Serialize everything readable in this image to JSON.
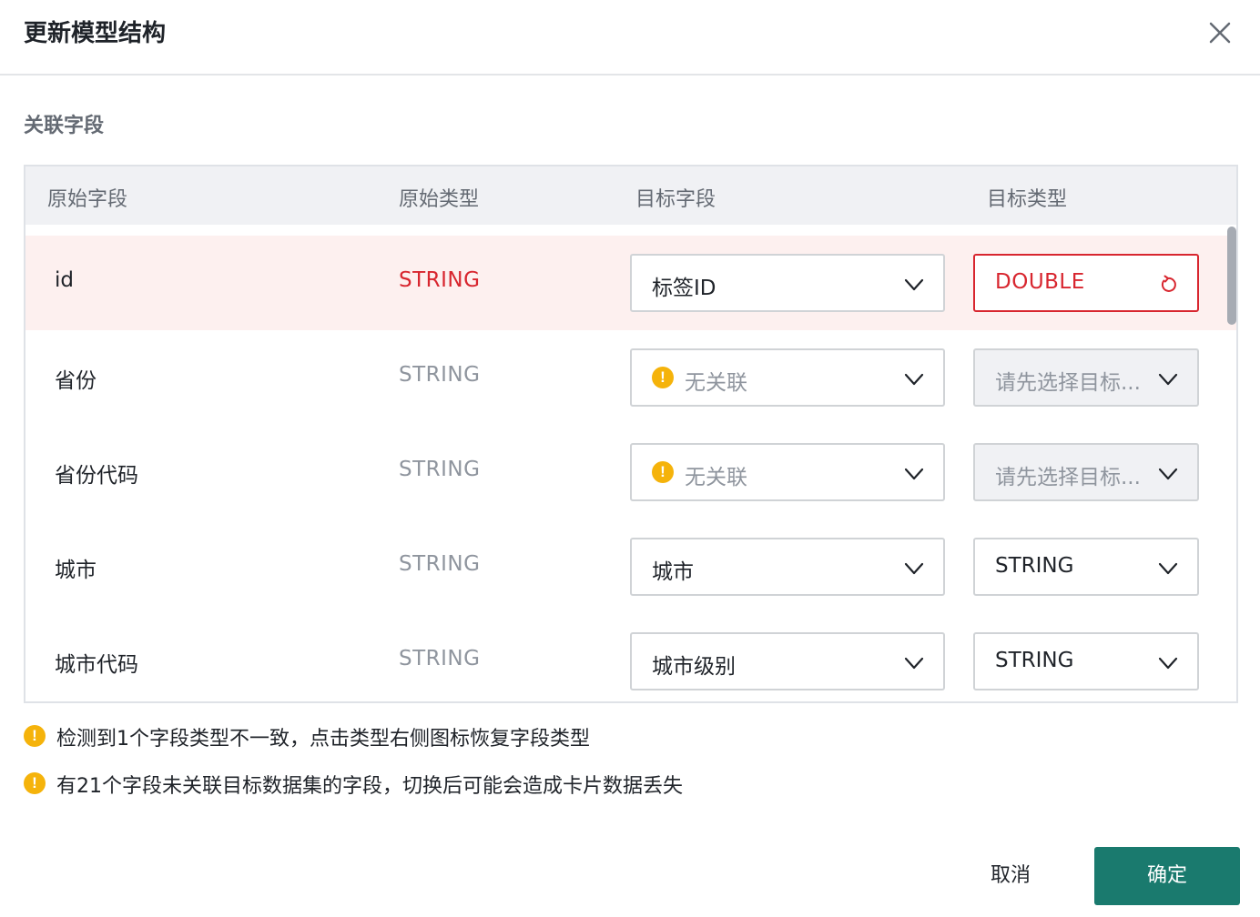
{
  "dialog": {
    "title": "更新模型结构",
    "section_label": "关联字段"
  },
  "table": {
    "headers": [
      "原始字段",
      "原始类型",
      "目标字段",
      "目标类型"
    ],
    "rows": [
      {
        "source_field": "id",
        "source_type": "STRING",
        "target_field": "标签ID",
        "target_type": "DOUBLE"
      },
      {
        "source_field": "省份",
        "source_type": "STRING",
        "target_field": "无关联",
        "target_type": "请先选择目标..."
      },
      {
        "source_field": "省份代码",
        "source_type": "STRING",
        "target_field": "无关联",
        "target_type": "请先选择目标..."
      },
      {
        "source_field": "城市",
        "source_type": "STRING",
        "target_field": "城市",
        "target_type": "STRING"
      },
      {
        "source_field": "城市代码",
        "source_type": "STRING",
        "target_field": "城市级别",
        "target_type": "STRING"
      }
    ]
  },
  "notices": [
    "检测到1个字段类型不一致，点击类型右侧图标恢复字段类型",
    "有21个字段未关联目标数据集的字段，切换后可能会造成卡片数据丢失"
  ],
  "footer": {
    "cancel_label": "取消",
    "confirm_label": "确定"
  },
  "colors": {
    "error": "#d8262f",
    "warning": "#f5b30b",
    "primary": "#1a7a6e"
  },
  "icons": {
    "warning_glyph": "!"
  }
}
